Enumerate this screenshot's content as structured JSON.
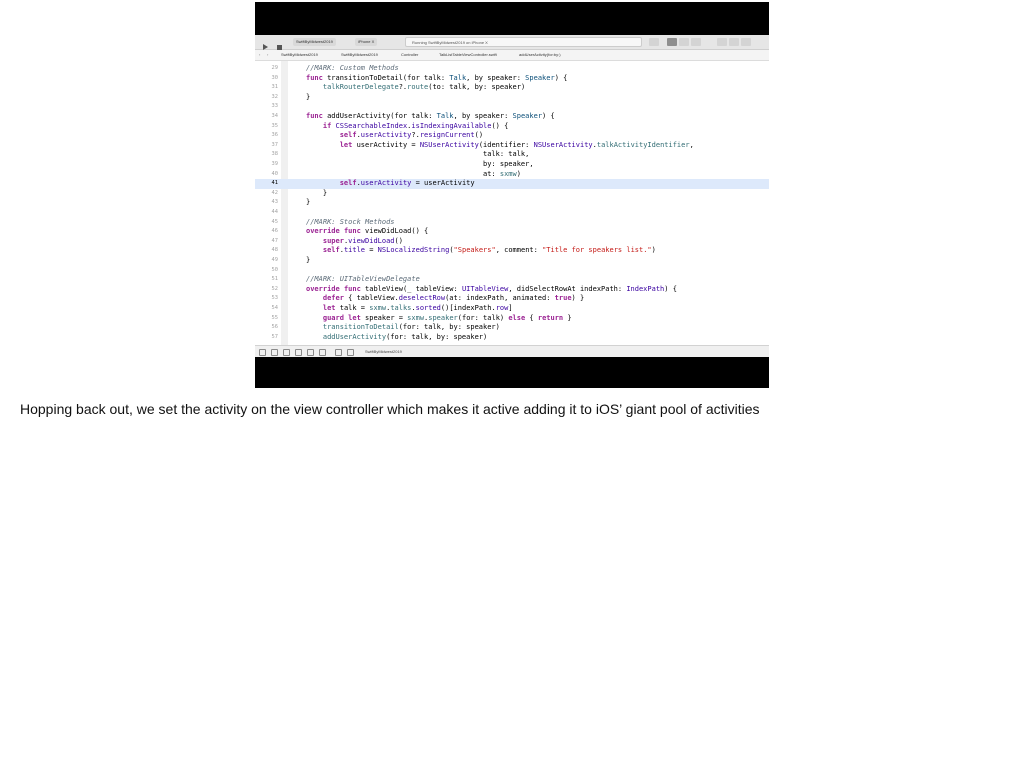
{
  "toolbar": {
    "scheme": "SwiftByMidwest2019",
    "device": "iPhone X",
    "status": "Running SwiftByMidwest2019 on iPhone X"
  },
  "jumpbar": {
    "crumbs": [
      "SwiftByMidwest2019",
      "SwiftByMidwest2019",
      "Controller",
      "TalkListTableViewController.swift",
      "addUserActivity(for:by:)"
    ]
  },
  "editor": {
    "lines": [
      {
        "n": "29"
      },
      {
        "n": "30"
      },
      {
        "n": "31"
      },
      {
        "n": "32"
      },
      {
        "n": "33"
      },
      {
        "n": "34"
      },
      {
        "n": "35"
      },
      {
        "n": "36"
      },
      {
        "n": "37"
      },
      {
        "n": "38"
      },
      {
        "n": "39"
      },
      {
        "n": "40"
      },
      {
        "n": "41"
      },
      {
        "n": "42"
      },
      {
        "n": "43"
      },
      {
        "n": "44"
      },
      {
        "n": "45"
      },
      {
        "n": "46"
      },
      {
        "n": "47"
      },
      {
        "n": "48"
      },
      {
        "n": "49"
      },
      {
        "n": "50"
      },
      {
        "n": "51"
      },
      {
        "n": "52"
      },
      {
        "n": "53"
      },
      {
        "n": "54"
      },
      {
        "n": "55"
      },
      {
        "n": "56"
      },
      {
        "n": "57"
      }
    ],
    "current_line": "41"
  },
  "debugbar": {
    "target": "SwiftByMidwest2019"
  },
  "caption": "Hopping back out, we set the activity on the view controller which makes it active adding it to iOS’ giant pool of activities"
}
